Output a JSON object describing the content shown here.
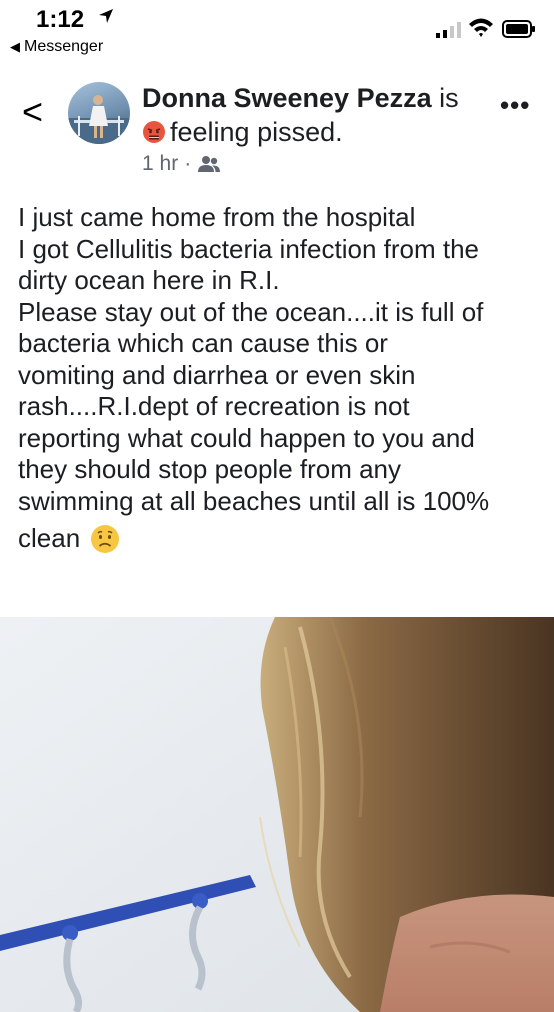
{
  "status_bar": {
    "time": "1:12",
    "back_app": "Messenger",
    "icons": [
      "location-arrow-icon",
      "cellular-signal-icon",
      "wifi-icon",
      "battery-icon"
    ]
  },
  "post": {
    "author": "Donna Sweeney Pezza",
    "author_suffix": "is",
    "feeling": "feeling pissed.",
    "feeling_emoji": "pouting-face-emoji",
    "timestamp": "1 hr",
    "audience_icon": "friends-icon",
    "body_lines": [
      "I just came home from the hospital",
      "I got Cellulitis bacteria infection from the",
      "dirty ocean here in R.I.",
      "Please stay out of the ocean....it is full of",
      "bacteria which can cause this or",
      "vomiting and diarrhea or even skin",
      "rash....R.I.dept of recreation is not",
      "reporting what could happen to you and",
      "they should stop people from any",
      "swimming at all beaches until all is 100%",
      "clean"
    ],
    "end_emoji": "worried-face-emoji"
  },
  "colors": {
    "text": "#1c1e21",
    "secondary_text": "#606770",
    "hook_blue": "#2f4fb5"
  }
}
